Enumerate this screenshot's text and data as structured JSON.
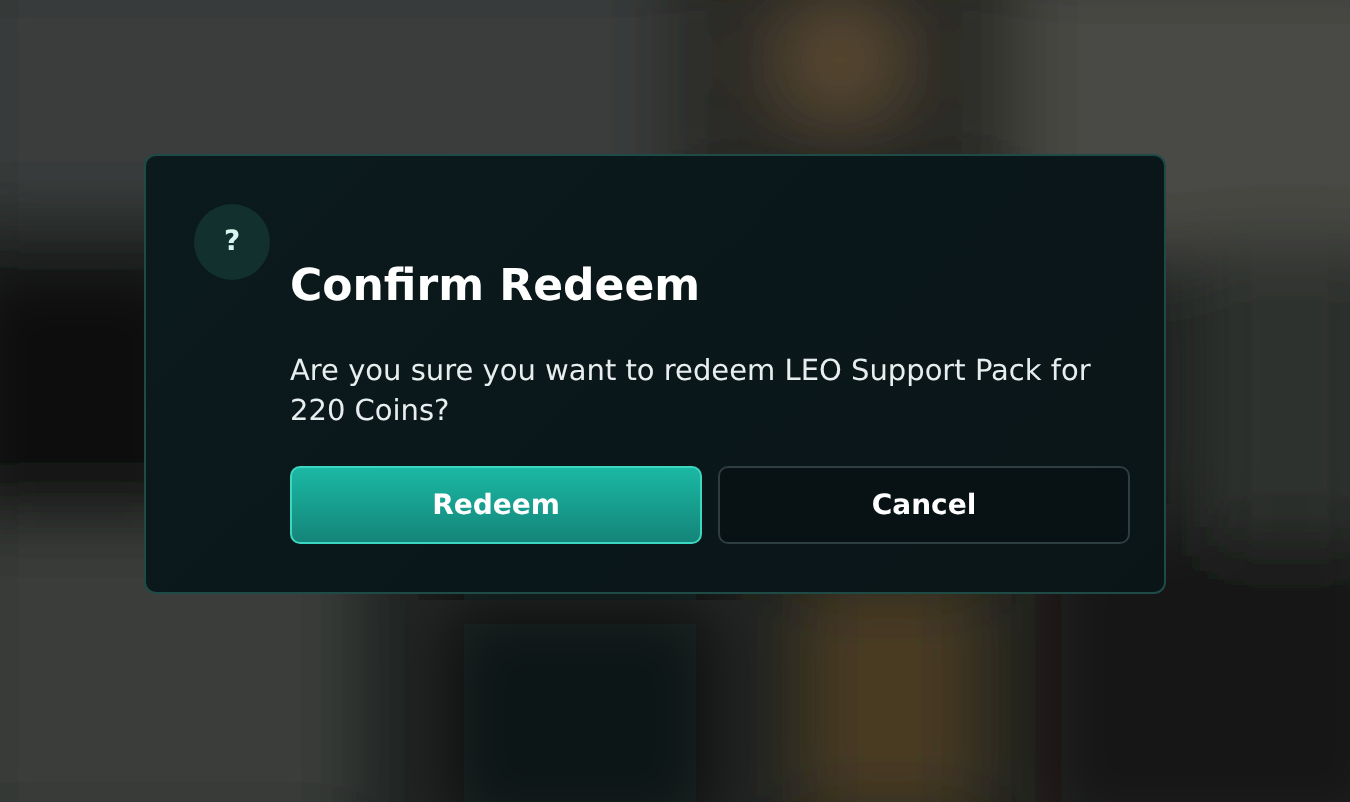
{
  "dialog": {
    "icon": "?",
    "title": "Confirm Redeem",
    "message": "Are you sure you want to redeem LEO Support Pack for 220 Coins?",
    "buttons": [
      {
        "label": "Redeem",
        "kind": "primary"
      },
      {
        "label": "Cancel",
        "kind": "secondary"
      }
    ]
  }
}
